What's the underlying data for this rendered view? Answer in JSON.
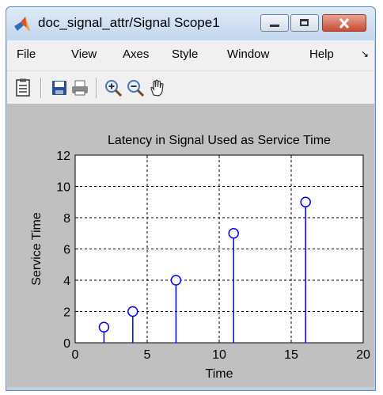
{
  "window": {
    "title": "doc_signal_attr/Signal Scope1"
  },
  "menu": {
    "items": [
      "File",
      "View",
      "Axes",
      "Style",
      "Window",
      "Help"
    ]
  },
  "toolbar": {
    "icons": [
      "parameters-icon",
      "save-icon",
      "print-icon",
      "zoom-in-icon",
      "zoom-out-icon",
      "pan-hand-icon"
    ]
  },
  "colors": {
    "series": "#0000ff",
    "plot_bg": "#ffffff",
    "figure_bg": "#c0c0c0"
  },
  "chart_data": {
    "type": "stem",
    "title": "Latency in Signal Used as Service Time",
    "xlabel": "Time",
    "ylabel": "Service Time",
    "xlim": [
      0,
      20
    ],
    "ylim": [
      0,
      12
    ],
    "xticks": [
      0,
      5,
      10,
      15,
      20
    ],
    "yticks": [
      0,
      2,
      4,
      6,
      8,
      10,
      12
    ],
    "grid": true,
    "x": [
      2,
      4,
      7,
      11,
      16
    ],
    "y": [
      1,
      2,
      4,
      7,
      9
    ]
  }
}
